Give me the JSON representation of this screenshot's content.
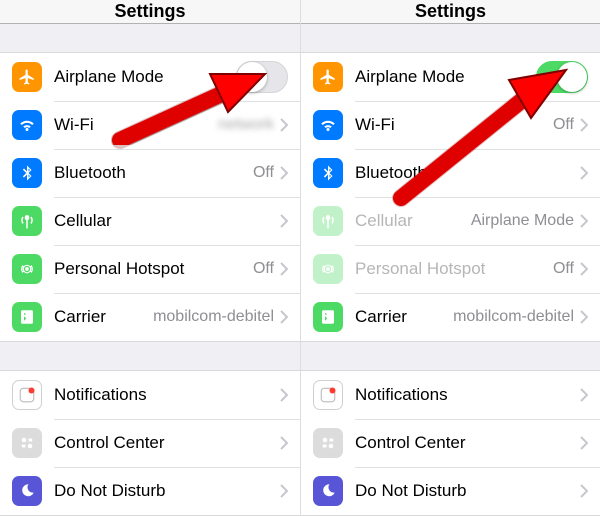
{
  "left": {
    "title": "Settings",
    "group1": [
      {
        "icon": "airplane-icon",
        "bg": "#ff9500",
        "label": "Airplane Mode",
        "value": null,
        "toggle": true,
        "on": false,
        "link": false,
        "dim": false,
        "blur": false
      },
      {
        "icon": "wifi-icon",
        "bg": "#007aff",
        "label": "Wi-Fi",
        "value": "network",
        "toggle": false,
        "on": false,
        "link": true,
        "dim": false,
        "blur": true
      },
      {
        "icon": "bluetooth-icon",
        "bg": "#007aff",
        "label": "Bluetooth",
        "value": "Off",
        "toggle": false,
        "on": false,
        "link": true,
        "dim": false,
        "blur": false
      },
      {
        "icon": "cellular-icon",
        "bg": "#4cd964",
        "label": "Cellular",
        "value": null,
        "toggle": false,
        "on": false,
        "link": true,
        "dim": false,
        "blur": false
      },
      {
        "icon": "hotspot-icon",
        "bg": "#4cd964",
        "label": "Personal Hotspot",
        "value": "Off",
        "toggle": false,
        "on": false,
        "link": true,
        "dim": false,
        "blur": false
      },
      {
        "icon": "carrier-icon",
        "bg": "#4cd964",
        "label": "Carrier",
        "value": "mobilcom-debitel",
        "toggle": false,
        "on": false,
        "link": true,
        "dim": false,
        "blur": false
      }
    ],
    "group2": [
      {
        "icon": "notifications-icon",
        "bg": "#fe3b30",
        "label": "Notifications",
        "link": true,
        "dim": false,
        "gray": true
      },
      {
        "icon": "controlcenter-icon",
        "bg": "#8e8e93",
        "label": "Control Center",
        "link": true,
        "dim": false,
        "gray": true
      },
      {
        "icon": "dnd-icon",
        "bg": "#5856d6",
        "label": "Do Not Disturb",
        "link": true,
        "dim": false
      }
    ]
  },
  "right": {
    "title": "Settings",
    "group1": [
      {
        "icon": "airplane-icon",
        "bg": "#ff9500",
        "label": "Airplane Mode",
        "value": null,
        "toggle": true,
        "on": true,
        "link": false,
        "dim": false,
        "blur": false
      },
      {
        "icon": "wifi-icon",
        "bg": "#007aff",
        "label": "Wi-Fi",
        "value": "Off",
        "toggle": false,
        "on": false,
        "link": true,
        "dim": false,
        "blur": false
      },
      {
        "icon": "bluetooth-icon",
        "bg": "#007aff",
        "label": "Bluetooth",
        "value": null,
        "toggle": false,
        "on": false,
        "link": true,
        "dim": false,
        "blur": false
      },
      {
        "icon": "cellular-icon",
        "bg": "#4cd964",
        "label": "Cellular",
        "value": "Airplane Mode",
        "toggle": false,
        "on": false,
        "link": true,
        "dim": true,
        "blur": false
      },
      {
        "icon": "hotspot-icon",
        "bg": "#4cd964",
        "label": "Personal Hotspot",
        "value": "Off",
        "toggle": false,
        "on": false,
        "link": true,
        "dim": true,
        "blur": false
      },
      {
        "icon": "carrier-icon",
        "bg": "#4cd964",
        "label": "Carrier",
        "value": "mobilcom-debitel",
        "toggle": false,
        "on": false,
        "link": true,
        "dim": false,
        "blur": false
      }
    ],
    "group2": [
      {
        "icon": "notifications-icon",
        "bg": "#fe3b30",
        "label": "Notifications",
        "link": true,
        "dim": false,
        "gray": true
      },
      {
        "icon": "controlcenter-icon",
        "bg": "#8e8e93",
        "label": "Control Center",
        "link": true,
        "dim": false,
        "gray": true
      },
      {
        "icon": "dnd-icon",
        "bg": "#5856d6",
        "label": "Do Not Disturb",
        "link": true,
        "dim": false
      }
    ]
  },
  "colors": {
    "chevron": "#c7c7cc",
    "arrow": "#ff0000",
    "arrowStroke": "#800000"
  }
}
